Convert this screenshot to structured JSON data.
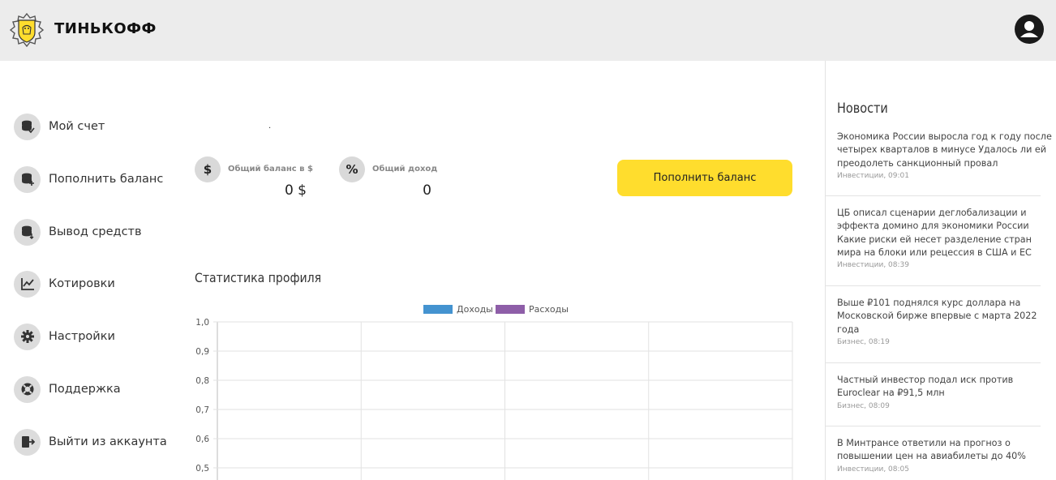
{
  "header": {
    "brand": "ТИНЬКОФФ"
  },
  "sidebar": {
    "items": [
      {
        "label": "Мой счет",
        "icon": "coins-check-icon"
      },
      {
        "label": "Пополнить баланс",
        "icon": "coins-plus-icon"
      },
      {
        "label": "Вывод средств",
        "icon": "coins-withdraw-icon"
      },
      {
        "label": "Котировки",
        "icon": "chart-line-icon"
      },
      {
        "label": "Настройки",
        "icon": "gear-icon"
      },
      {
        "label": "Поддержка",
        "icon": "lifebuoy-icon"
      },
      {
        "label": "Выйти из аккаунта",
        "icon": "logout-icon"
      }
    ]
  },
  "main": {
    "dot": ".",
    "balance": {
      "icon": "$",
      "label": "Общий баланс в $",
      "value": "0 $"
    },
    "income": {
      "icon": "%",
      "label": "Общий доход",
      "value": "0"
    },
    "topup_button": "Пополнить баланс",
    "stats_title": "Статистика профиля"
  },
  "chart_data": {
    "type": "bar",
    "series": [
      {
        "name": "Доходы",
        "color": "#4493d0",
        "values": []
      },
      {
        "name": "Расходы",
        "color": "#8e5ea8",
        "values": []
      }
    ],
    "y_ticks": [
      "1,0",
      "0,9",
      "0,8",
      "0,7",
      "0,6",
      "0,5"
    ],
    "ylim": [
      0,
      1
    ],
    "grid": true,
    "legend_position": "top"
  },
  "news": {
    "title": "Новости",
    "items": [
      {
        "text": "Экономика России выросла год к году после четырех кварталов в минусе Удалось ли ей преодолеть санкционный провал",
        "meta": "Инвестиции, 09:01"
      },
      {
        "text": "ЦБ описал сценарии деглобализации и эффекта домино для экономики России Какие риски ей несет разделение стран мира на блоки или рецессия в США и ЕС",
        "meta": "Инвестиции, 08:39"
      },
      {
        "text": "Выше ₽101 поднялся курс доллара на Московской бирже впервые с марта 2022 года",
        "meta": "Бизнес, 08:19"
      },
      {
        "text": "Частный инвестор подал иск против Euroclear на ₽91,5 млн",
        "meta": "Бизнес, 08:09"
      },
      {
        "text": "В Минтрансе ответили на прогноз о повышении цен на авиабилеты до 40%",
        "meta": "Инвестиции, 08:05"
      }
    ]
  }
}
